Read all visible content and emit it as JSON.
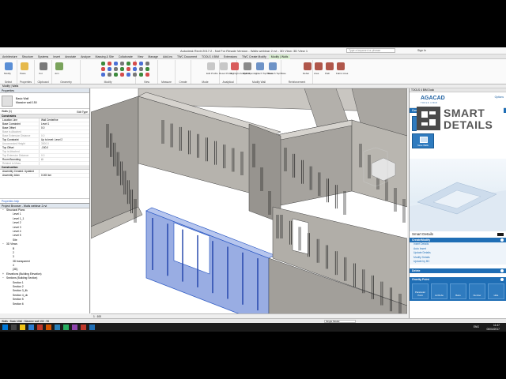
{
  "window": {
    "title": "Autodesk Revit 2017.2 - Not For Resale Version - Walls webinar 2.rvt - 3D View: 3D View 1",
    "search_placeholder": "Type a keyword or phrase",
    "signin": "Sign In"
  },
  "ribbon_tabs": [
    "Architecture",
    "Structure",
    "Systems",
    "Insert",
    "Annotate",
    "Analyze",
    "Massing & Site",
    "Collaborate",
    "View",
    "Manage",
    "Add-Ins",
    "TWC Document",
    "TOOLS 4 BIM",
    "Extensions",
    "TWC Create Modify",
    "Modify | Walls"
  ],
  "active_tab_index": 15,
  "ribbon_groups": [
    "Select",
    "Properties",
    "Clipboard",
    "Geometry",
    "Modify",
    "View",
    "Measure",
    "Create",
    "Mode",
    "Analytical",
    "Modify Wall",
    "Reinforcement"
  ],
  "ribbon_buttons": [
    "Modify",
    "Paste",
    "Cut",
    "Join",
    "Edit Profile",
    "Reset Profile",
    "Highlight Analytical",
    "Wall Opening",
    "Attach Top/Base",
    "Detach Top/Base",
    "Rebar",
    "Area",
    "Path",
    "Fabric Area"
  ],
  "toolrow": "Modify | Walls",
  "properties": {
    "title": "Properties",
    "type_name": "Basic Wall",
    "type_sub": "Massive wall 150",
    "filter": "Walls (1)",
    "edit_type": "Edit Type",
    "groups": [
      {
        "name": "Constraints",
        "rows": [
          {
            "k": "Location Line",
            "v": "Wall Centerline",
            "dim": false
          },
          {
            "k": "Base Constraint",
            "v": "Level 1",
            "dim": false
          },
          {
            "k": "Base Offset",
            "v": "0.0",
            "dim": false
          },
          {
            "k": "Base is Attached",
            "v": "",
            "dim": true
          },
          {
            "k": "Base Extension Distance",
            "v": "0.0",
            "dim": true
          },
          {
            "k": "Top Constraint",
            "v": "Up to level: Level 2",
            "dim": false
          },
          {
            "k": "Unconnected Height",
            "v": "3000.0",
            "dim": true
          },
          {
            "k": "Top Offset",
            "v": "-150.0",
            "dim": false
          },
          {
            "k": "Top is Attached",
            "v": "",
            "dim": true
          },
          {
            "k": "Top Extension Distance",
            "v": "0.0",
            "dim": true
          },
          {
            "k": "Room Bounding",
            "v": "☑",
            "dim": false
          },
          {
            "k": "Related to Mass",
            "v": "",
            "dim": true
          }
        ]
      },
      {
        "name": "Construction",
        "rows": [
          {
            "k": "Assembly Created: Updated",
            "v": "",
            "dim": false
          },
          {
            "k": "Assembly Id/an",
            "v": "0.000 km",
            "dim": false
          }
        ]
      }
    ],
    "help": "Properties help",
    "apply": "Apply"
  },
  "browser": {
    "title": "Project Browser - Walls webinar 2.rvt",
    "items": [
      {
        "indent": 0,
        "sign": "−",
        "label": "Structural Plans"
      },
      {
        "indent": 1,
        "sign": "",
        "label": "Level 1"
      },
      {
        "indent": 1,
        "sign": "",
        "label": "Level 1_1"
      },
      {
        "indent": 1,
        "sign": "",
        "label": "Level 2"
      },
      {
        "indent": 1,
        "sign": "",
        "label": "Level 3"
      },
      {
        "indent": 1,
        "sign": "",
        "label": "Level 4"
      },
      {
        "indent": 1,
        "sign": "",
        "label": "Level 5"
      },
      {
        "indent": 1,
        "sign": "",
        "label": "Site"
      },
      {
        "indent": 0,
        "sign": "−",
        "label": "3D Views"
      },
      {
        "indent": 1,
        "sign": "",
        "label": "B"
      },
      {
        "indent": 1,
        "sign": "",
        "label": "2"
      },
      {
        "indent": 1,
        "sign": "",
        "label": "3"
      },
      {
        "indent": 1,
        "sign": "",
        "label": "3D transparent"
      },
      {
        "indent": 1,
        "sign": "",
        "label": "4"
      },
      {
        "indent": 1,
        "sign": "",
        "label": "{3D}"
      },
      {
        "indent": 0,
        "sign": "+",
        "label": "Elevations (Building Elevation)"
      },
      {
        "indent": 0,
        "sign": "−",
        "label": "Sections (Building Section)"
      },
      {
        "indent": 1,
        "sign": "",
        "label": "Section 1"
      },
      {
        "indent": 1,
        "sign": "",
        "label": "Section 2"
      },
      {
        "indent": 1,
        "sign": "",
        "label": "Section 3_fik"
      },
      {
        "indent": 1,
        "sign": "",
        "label": "Section 4_ok"
      },
      {
        "indent": 1,
        "sign": "",
        "label": "Section 5"
      },
      {
        "indent": 1,
        "sign": "",
        "label": "Section 6"
      }
    ]
  },
  "viewport": {
    "scale": "1 : 100"
  },
  "status": {
    "text": "Walls : Basic Wall : Massive wall 150 : 96",
    "select_value": "Single Model"
  },
  "panel": {
    "header": "TOOLS 4 BIM Dock",
    "brand": "AGACAD",
    "brand_sub": "TOOLS 4 BIM",
    "options": "Options",
    "config": "Configuration",
    "buttons": [
      "Smart Walls",
      "Save Panel layout",
      "Smart Walls",
      "Save Walls"
    ],
    "sd_title": "Smart Details",
    "create_modify": "Create/Modify",
    "links": [
      "Insert Details",
      "Auto Insert",
      "Update Details",
      "Modify Details",
      "Update by BC"
    ],
    "delete": "Delete",
    "gravity": "Gravity Point",
    "gravity_buttons": [
      "Parameter Point",
      "Ad Robo",
      "Bedo",
      "Number",
      "Hide"
    ]
  },
  "logo": {
    "line1": "SMART",
    "line2": "DETAILS"
  },
  "taskbar": {
    "lang": "ENG",
    "time": "11:47",
    "date": "06/04/2017"
  },
  "colors": {
    "accent": "#1f6eb5",
    "selection": "#3a6fd8",
    "wall": "#a8a5a0"
  }
}
